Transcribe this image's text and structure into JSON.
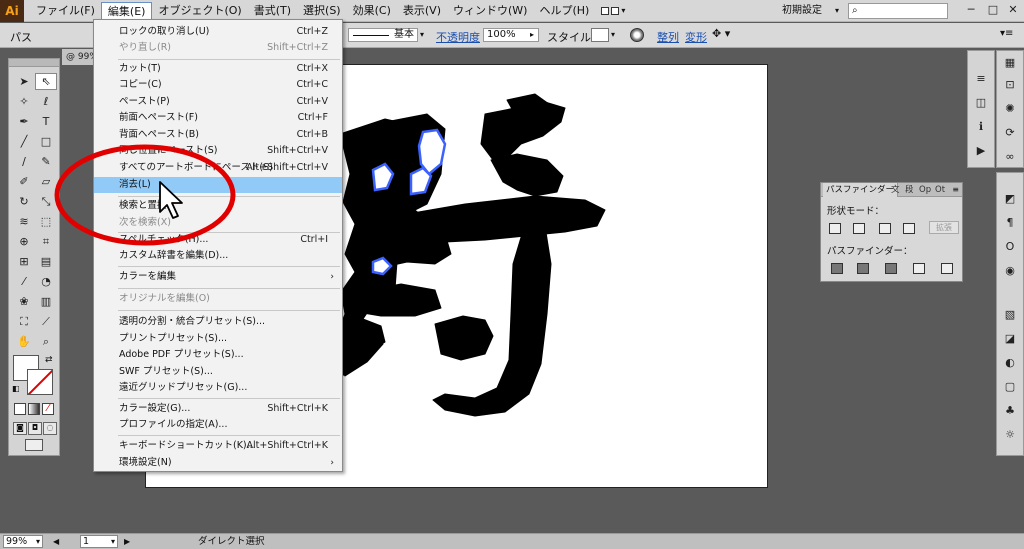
{
  "app": {
    "logo": "Ai"
  },
  "menubar": {
    "items": [
      "ファイル(F)",
      "編集(E)",
      "オブジェクト(O)",
      "書式(T)",
      "選択(S)",
      "効果(C)",
      "表示(V)",
      "ウィンドウ(W)",
      "ヘルプ(H)"
    ],
    "workspace": "初期設定",
    "search_icon": "search-icon",
    "window_buttons": {
      "minimize": "─",
      "maximize": "□",
      "close": "✕"
    }
  },
  "controlbar": {
    "path_label": "パス",
    "stroke_profile": "基本",
    "opacity_label": "不透明度",
    "opacity_value": "100%",
    "style_label": "スタイル：",
    "align_link": "整列",
    "transform_link": "変形"
  },
  "doc_tab": {
    "label": "@ 99%"
  },
  "edit_menu": {
    "items": [
      {
        "label": "ロックの取り消し(U)",
        "shortcut": "Ctrl+Z",
        "disabled": false
      },
      {
        "label": "やり直し(R)",
        "shortcut": "Shift+Ctrl+Z",
        "disabled": true
      },
      {
        "label": "カット(T)",
        "shortcut": "Ctrl+X",
        "disabled": false
      },
      {
        "label": "コピー(C)",
        "shortcut": "Ctrl+C",
        "disabled": false
      },
      {
        "label": "ペースト(P)",
        "shortcut": "Ctrl+V",
        "disabled": false
      },
      {
        "label": "前面へペースト(F)",
        "shortcut": "Ctrl+F",
        "disabled": false
      },
      {
        "label": "背面へペースト(B)",
        "shortcut": "Ctrl+B",
        "disabled": false
      },
      {
        "label": "同じ位置にペースト(S)",
        "shortcut": "Shift+Ctrl+V",
        "disabled": false
      },
      {
        "label": "すべてのアートボードにペースト(S)",
        "shortcut": "Alt+Shift+Ctrl+V",
        "disabled": false
      },
      {
        "label": "消去(L)",
        "shortcut": "",
        "disabled": false,
        "highlighted": true
      },
      {
        "label": "検索と置換...",
        "shortcut": "",
        "disabled": false
      },
      {
        "label": "次を検索(X)",
        "shortcut": "",
        "disabled": true
      },
      {
        "label": "スペルチェック(H)...",
        "shortcut": "Ctrl+I",
        "disabled": false
      },
      {
        "label": "カスタム辞書を編集(D)...",
        "shortcut": "",
        "disabled": false
      },
      {
        "label": "カラーを編集",
        "shortcut": "",
        "submenu": true
      },
      {
        "label": "オリジナルを編集(O)",
        "shortcut": "",
        "disabled": true
      },
      {
        "label": "透明の分割・統合プリセット(S)...",
        "shortcut": "",
        "disabled": false
      },
      {
        "label": "プリントプリセット(S)...",
        "shortcut": "",
        "disabled": false
      },
      {
        "label": "Adobe PDF プリセット(S)...",
        "shortcut": "",
        "disabled": false
      },
      {
        "label": "SWF プリセット(S)...",
        "shortcut": "",
        "disabled": false
      },
      {
        "label": "遠近グリッドプリセット(G)...",
        "shortcut": "",
        "disabled": false
      },
      {
        "label": "カラー設定(G)...",
        "shortcut": "Shift+Ctrl+K",
        "disabled": false
      },
      {
        "label": "プロファイルの指定(A)...",
        "shortcut": "",
        "disabled": false
      },
      {
        "label": "キーボードショートカット(K)...",
        "shortcut": "Alt+Shift+Ctrl+K",
        "disabled": false
      },
      {
        "label": "環境設定(N)",
        "shortcut": "",
        "submenu": true
      }
    ],
    "submenu_arrow": "›"
  },
  "pathfinder": {
    "tab_label": "パスファインダー",
    "sub_tabs": [
      "文",
      "段",
      "Op",
      "Ot"
    ],
    "shape_mode_label": "形状モード：",
    "pathfinder_label": "パスファインダー：",
    "expand_button": "拡張"
  },
  "statusbar": {
    "zoom": "99%",
    "page": "1",
    "status": "ダイレクト選択"
  },
  "colors": {
    "highlight": "#91c9f7",
    "annotation": "#e10000",
    "selection_outline": "#3b62ff"
  }
}
